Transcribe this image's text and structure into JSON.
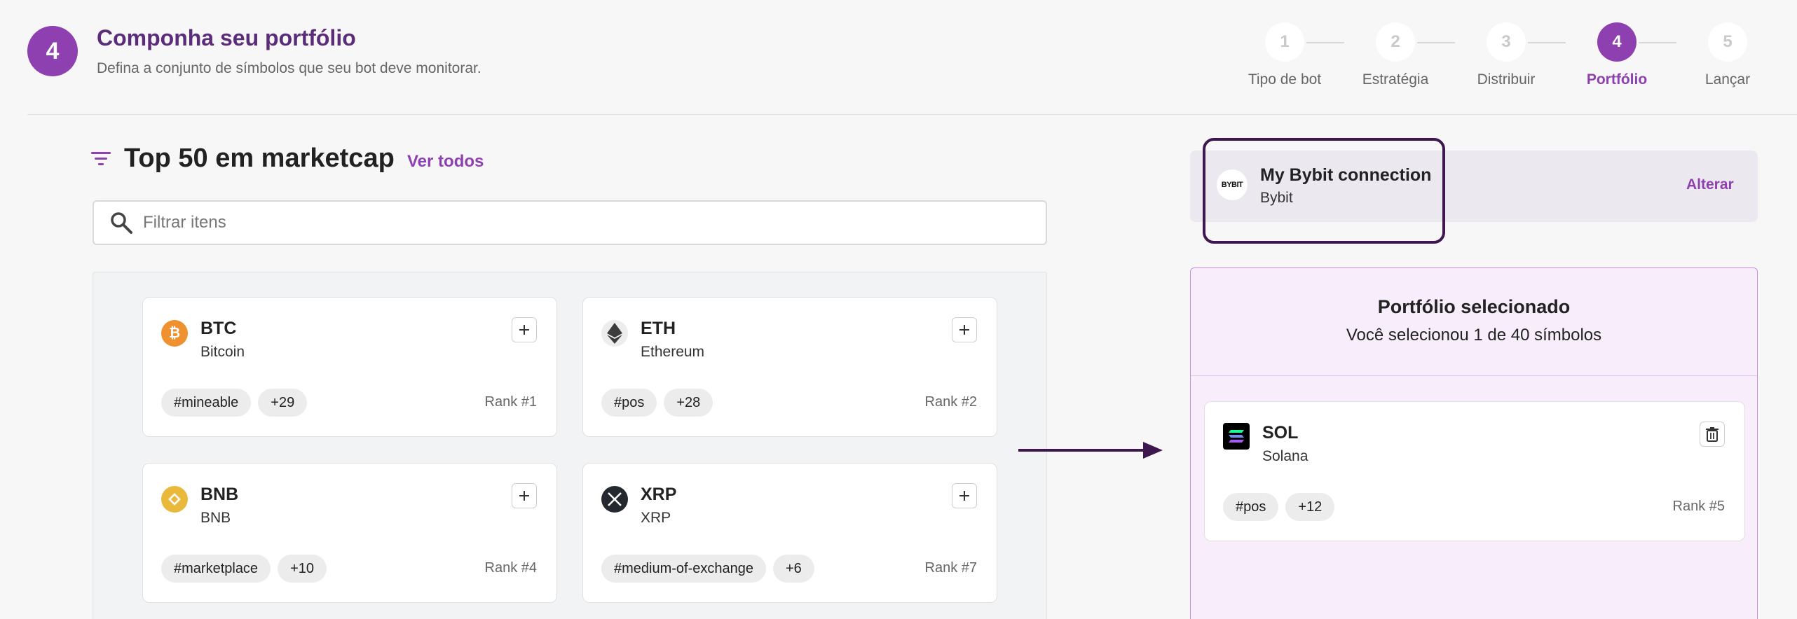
{
  "header": {
    "step_number": "4",
    "title": "Componha seu portfólio",
    "subtitle": "Defina a conjunto de símbolos que seu bot deve monitorar."
  },
  "stepper": {
    "steps": [
      {
        "number": "1",
        "label": "Tipo de bot"
      },
      {
        "number": "2",
        "label": "Estratégia"
      },
      {
        "number": "3",
        "label": "Distribuir"
      },
      {
        "number": "4",
        "label": "Portfólio"
      },
      {
        "number": "5",
        "label": "Lançar"
      }
    ],
    "active_step": 4
  },
  "list": {
    "title": "Top 50 em marketcap",
    "see_all": "Ver todos",
    "search_placeholder": "Filtrar itens",
    "cards": [
      {
        "symbol": "BTC",
        "name": "Bitcoin",
        "tags": [
          "#mineable",
          "+29"
        ],
        "rank": "Rank #1",
        "icon": "bitcoin-icon",
        "color": "#f0912f"
      },
      {
        "symbol": "ETH",
        "name": "Ethereum",
        "tags": [
          "#pos",
          "+28"
        ],
        "rank": "Rank #2",
        "icon": "ethereum-icon",
        "color": "#3c3c3d"
      },
      {
        "symbol": "BNB",
        "name": "BNB",
        "tags": [
          "#marketplace",
          "+10"
        ],
        "rank": "Rank #4",
        "icon": "bnb-icon",
        "color": "#e8b93a"
      },
      {
        "symbol": "XRP",
        "name": "XRP",
        "tags": [
          "#medium-of-exchange",
          "+6"
        ],
        "rank": "Rank #7",
        "icon": "xrp-icon",
        "color": "#23292f"
      }
    ]
  },
  "connection": {
    "logo_text": "BYBIT",
    "name": "My Bybit connection",
    "exchange": "Bybit",
    "change_label": "Alterar"
  },
  "portfolio": {
    "title": "Portfólio selecionado",
    "count_text": "Você selecionou 1 de 40 símbolos",
    "selected": [
      {
        "symbol": "SOL",
        "name": "Solana",
        "tags": [
          "#pos",
          "+12"
        ],
        "rank": "Rank #5",
        "icon": "solana-icon"
      }
    ]
  },
  "colors": {
    "accent": "#8e3fb0",
    "title_purple": "#5b2c7a",
    "highlight_border": "#3e1750"
  }
}
